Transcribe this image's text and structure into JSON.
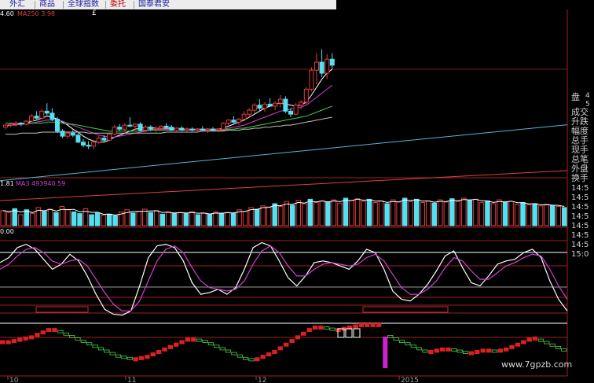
{
  "tabs": [
    {
      "label": "外汇",
      "active": false
    },
    {
      "label": "商品",
      "active": false
    },
    {
      "label": "全球指数",
      "active": false
    },
    {
      "label": "委托",
      "active": true
    },
    {
      "label": "国泰君安",
      "active": false
    }
  ],
  "pound_glyph": "£",
  "main_legend": {
    "left_value": "4.60",
    "ma250_label": "MA250 3.98"
  },
  "volume_legend": {
    "left_value": "1.81",
    "ma3_label": "MA3 493940.59"
  },
  "osc_legend": {
    "left_value": "0.00"
  },
  "side_panel": {
    "labels": [
      "盘",
      "成交",
      "升跌",
      "幅度",
      "总手",
      "现手",
      "总笔",
      "外盘",
      "换手"
    ],
    "right_digits": [
      "4",
      "5"
    ],
    "times": [
      "14:5",
      "14:5",
      "14:5",
      "14:5",
      "14:5",
      "14:5",
      "14:5",
      "15:0"
    ]
  },
  "x_axis": {
    "labels": [
      "10",
      "11",
      "12",
      "2015"
    ]
  },
  "watermark": "www.7gpzb.com",
  "colors": {
    "up": "#e33b3b",
    "down": "#54e0f0",
    "grid": "#6a1a1a",
    "background": "#000000"
  },
  "chart_data": [
    {
      "type": "line",
      "panel": "price",
      "description_of_marks": "daily candlesticks with moving averages",
      "candles": [
        [
          4.12,
          4.15,
          4.1,
          4.14
        ],
        [
          4.14,
          4.16,
          4.12,
          4.15
        ],
        [
          4.15,
          4.18,
          4.13,
          4.16
        ],
        [
          4.16,
          4.17,
          4.13,
          4.15
        ],
        [
          4.15,
          4.19,
          4.14,
          4.18
        ],
        [
          4.18,
          4.25,
          4.16,
          4.23
        ],
        [
          4.23,
          4.28,
          4.2,
          4.21
        ],
        [
          4.21,
          4.3,
          4.2,
          4.28
        ],
        [
          4.28,
          4.36,
          4.24,
          4.26
        ],
        [
          4.26,
          4.31,
          4.18,
          4.2
        ],
        [
          4.2,
          4.22,
          4.06,
          4.08
        ],
        [
          4.08,
          4.1,
          4.01,
          4.03
        ],
        [
          4.03,
          4.08,
          4.0,
          4.06
        ],
        [
          4.06,
          4.09,
          4.02,
          4.04
        ],
        [
          4.04,
          4.06,
          3.96,
          3.97
        ],
        [
          3.97,
          4.0,
          3.92,
          3.94
        ],
        [
          3.94,
          3.98,
          3.9,
          3.93
        ],
        [
          3.93,
          3.99,
          3.9,
          3.97
        ],
        [
          3.97,
          4.03,
          3.95,
          4.01
        ],
        [
          4.01,
          4.04,
          3.97,
          3.99
        ],
        [
          3.99,
          4.06,
          3.98,
          4.05
        ],
        [
          4.05,
          4.14,
          4.04,
          4.12
        ],
        [
          4.12,
          4.15,
          4.08,
          4.1
        ],
        [
          4.1,
          4.16,
          4.08,
          4.14
        ],
        [
          4.14,
          4.22,
          4.12,
          4.13
        ],
        [
          4.13,
          4.16,
          4.09,
          4.15
        ],
        [
          4.15,
          4.17,
          4.08,
          4.09
        ],
        [
          4.09,
          4.14,
          4.07,
          4.12
        ],
        [
          4.12,
          4.14,
          4.08,
          4.1
        ],
        [
          4.1,
          4.13,
          4.07,
          4.11
        ],
        [
          4.11,
          4.14,
          4.09,
          4.13
        ],
        [
          4.13,
          4.16,
          4.11,
          4.12
        ],
        [
          4.12,
          4.14,
          4.08,
          4.09
        ],
        [
          4.09,
          4.12,
          4.07,
          4.11
        ],
        [
          4.11,
          4.13,
          4.08,
          4.09
        ],
        [
          4.09,
          4.12,
          4.07,
          4.1
        ],
        [
          4.1,
          4.12,
          4.08,
          4.09
        ],
        [
          4.09,
          4.11,
          4.07,
          4.1
        ],
        [
          4.1,
          4.13,
          4.08,
          4.09
        ],
        [
          4.09,
          4.11,
          4.06,
          4.1
        ],
        [
          4.1,
          4.12,
          4.08,
          4.09
        ],
        [
          4.09,
          4.11,
          4.07,
          4.1
        ],
        [
          4.1,
          4.17,
          4.09,
          4.16
        ],
        [
          4.16,
          4.2,
          4.14,
          4.19
        ],
        [
          4.19,
          4.23,
          4.16,
          4.17
        ],
        [
          4.17,
          4.21,
          4.14,
          4.2
        ],
        [
          4.2,
          4.28,
          4.18,
          4.25
        ],
        [
          4.25,
          4.31,
          4.22,
          4.29
        ],
        [
          4.29,
          4.36,
          4.26,
          4.34
        ],
        [
          4.34,
          4.4,
          4.28,
          4.31
        ],
        [
          4.31,
          4.37,
          4.27,
          4.35
        ],
        [
          4.35,
          4.41,
          4.32,
          4.33
        ],
        [
          4.33,
          4.38,
          4.29,
          4.36
        ],
        [
          4.36,
          4.44,
          4.32,
          4.4
        ],
        [
          4.4,
          4.43,
          4.26,
          4.28
        ],
        [
          4.28,
          4.31,
          4.22,
          4.25
        ],
        [
          4.25,
          4.36,
          4.24,
          4.34
        ],
        [
          4.34,
          4.39,
          4.3,
          4.37
        ],
        [
          4.37,
          4.52,
          4.35,
          4.5
        ],
        [
          4.5,
          4.72,
          4.48,
          4.69
        ],
        [
          4.69,
          4.86,
          4.55,
          4.77
        ],
        [
          4.77,
          4.9,
          4.62,
          4.66
        ],
        [
          4.66,
          4.85,
          4.6,
          4.8
        ],
        [
          4.8,
          4.86,
          4.7,
          4.74
        ]
      ],
      "ma_series": [
        {
          "color": "#ffffff",
          "values": [
            4.13,
            4.14,
            4.15,
            4.15,
            4.16,
            4.18,
            4.19,
            4.21,
            4.23,
            4.22,
            4.2,
            4.17,
            4.14,
            4.1,
            4.07,
            4.03,
            4.0,
            3.98,
            3.97,
            3.97,
            3.99,
            4.02,
            4.04,
            4.06,
            4.08,
            4.1,
            4.11,
            4.12,
            4.12,
            4.11,
            4.11,
            4.11,
            4.11,
            4.11,
            4.1,
            4.1,
            4.1,
            4.1,
            4.1,
            4.1,
            4.1,
            4.1,
            4.11,
            4.13,
            4.15,
            4.17,
            4.19,
            4.22,
            4.25,
            4.28,
            4.31,
            4.33,
            4.35,
            4.36,
            4.35,
            4.34,
            4.33,
            4.34,
            4.37,
            4.44,
            4.52,
            4.6,
            4.66,
            4.7
          ]
        },
        {
          "color": "#d040d0",
          "values": [
            4.14,
            4.14,
            4.14,
            4.15,
            4.15,
            4.16,
            4.17,
            4.18,
            4.19,
            4.19,
            4.19,
            4.18,
            4.16,
            4.14,
            4.12,
            4.1,
            4.08,
            4.06,
            4.04,
            4.03,
            4.02,
            4.02,
            4.03,
            4.04,
            4.05,
            4.06,
            4.07,
            4.08,
            4.09,
            4.1,
            4.1,
            4.1,
            4.1,
            4.1,
            4.1,
            4.1,
            4.1,
            4.1,
            4.1,
            4.1,
            4.1,
            4.1,
            4.1,
            4.11,
            4.12,
            4.13,
            4.14,
            4.16,
            4.18,
            4.2,
            4.22,
            4.24,
            4.26,
            4.28,
            4.29,
            4.3,
            4.31,
            4.32,
            4.34,
            4.38,
            4.42,
            4.46,
            4.5,
            4.54
          ]
        },
        {
          "color": "#40d040",
          "values": [
            4.16,
            4.16,
            4.16,
            4.16,
            4.16,
            4.16,
            4.16,
            4.16,
            4.17,
            4.17,
            4.17,
            4.16,
            4.15,
            4.15,
            4.14,
            4.13,
            4.12,
            4.11,
            4.1,
            4.09,
            4.08,
            4.08,
            4.08,
            4.08,
            4.08,
            4.08,
            4.08,
            4.09,
            4.09,
            4.09,
            4.09,
            4.09,
            4.09,
            4.09,
            4.09,
            4.09,
            4.09,
            4.09,
            4.09,
            4.09,
            4.09,
            4.09,
            4.09,
            4.1,
            4.1,
            4.11,
            4.11,
            4.12,
            4.13,
            4.14,
            4.15,
            4.16,
            4.17,
            4.18,
            4.19,
            4.2,
            4.21,
            4.22,
            4.23,
            4.25,
            4.27,
            4.29,
            4.31,
            4.33
          ]
        },
        {
          "color": "#c0c0c0",
          "values": [
            4.05,
            4.05,
            4.05,
            4.06,
            4.06,
            4.06,
            4.06,
            4.07,
            4.07,
            4.07,
            4.07,
            4.07,
            4.07,
            4.07,
            4.07,
            4.07,
            4.06,
            4.06,
            4.06,
            4.06,
            4.06,
            4.06,
            4.06,
            4.06,
            4.06,
            4.06,
            4.06,
            4.06,
            4.06,
            4.06,
            4.06,
            4.07,
            4.07,
            4.07,
            4.07,
            4.07,
            4.07,
            4.07,
            4.08,
            4.08,
            4.08,
            4.08,
            4.08,
            4.09,
            4.09,
            4.09,
            4.1,
            4.1,
            4.11,
            4.11,
            4.12,
            4.12,
            4.13,
            4.13,
            4.14,
            4.14,
            4.15,
            4.16,
            4.17,
            4.18,
            4.19,
            4.2,
            4.21,
            4.22
          ]
        }
      ],
      "long_lines": [
        {
          "color": "#4fb7d8",
          "from": 3.82,
          "to": 4.38
        },
        {
          "color": "#e04040",
          "from": 3.7,
          "to": 4.0
        }
      ]
    },
    {
      "type": "bar",
      "panel": "volume",
      "values": [
        55,
        48,
        62,
        40,
        58,
        45,
        66,
        52,
        60,
        48,
        70,
        58,
        50,
        44,
        62,
        40,
        46,
        38,
        42,
        36,
        50,
        58,
        46,
        52,
        60,
        48,
        55,
        42,
        50,
        46,
        48,
        44,
        52,
        40,
        46,
        42,
        50,
        44,
        48,
        46,
        58,
        52,
        66,
        60,
        72,
        68,
        80,
        70,
        88,
        74,
        92,
        80,
        96,
        84,
        90,
        86,
        94,
        82,
        100,
        92,
        98,
        88,
        96,
        84,
        90,
        80,
        94,
        86,
        100,
        88,
        96,
        84,
        90,
        82,
        94,
        86,
        98,
        88,
        100,
        92,
        96,
        84,
        90,
        80,
        94,
        86,
        88,
        78,
        84,
        76,
        80,
        72,
        78,
        74,
        70,
        66
      ],
      "up_flags": [
        1,
        1,
        0,
        1,
        0,
        1,
        1,
        0,
        1,
        0,
        1,
        1,
        0,
        0,
        1,
        0,
        0,
        1,
        0,
        0,
        1,
        1,
        0,
        1,
        1,
        0,
        1,
        0,
        1,
        0,
        1,
        0,
        1,
        0,
        1,
        0,
        1,
        0,
        1,
        0,
        1,
        1,
        1,
        0,
        1,
        1,
        0,
        1,
        1,
        0,
        1,
        1,
        0,
        1,
        1,
        0,
        1,
        1,
        0,
        1,
        1,
        1,
        0,
        1,
        1,
        0,
        1,
        1,
        0,
        1,
        0,
        1,
        1,
        0,
        1,
        1,
        0,
        1,
        1,
        0,
        1,
        1,
        0,
        1,
        1,
        0,
        1,
        1,
        0,
        1,
        0,
        1,
        1,
        0,
        1,
        0
      ]
    },
    {
      "type": "line",
      "panel": "oscillator",
      "series": [
        {
          "color": "#ffffff",
          "values": [
            68,
            74,
            86,
            90,
            84,
            72,
            60,
            66,
            78,
            70,
            52,
            30,
            12,
            6,
            5,
            10,
            40,
            74,
            88,
            90,
            86,
            70,
            44,
            30,
            32,
            36,
            30,
            38,
            60,
            86,
            92,
            88,
            70,
            50,
            40,
            52,
            68,
            70,
            68,
            64,
            60,
            70,
            84,
            80,
            60,
            34,
            24,
            22,
            30,
            42,
            58,
            76,
            82,
            62,
            44,
            40,
            52,
            66,
            70,
            72,
            80,
            84,
            74,
            46,
            24,
            10
          ]
        },
        {
          "color": "#d040d0",
          "values": [
            60,
            66,
            76,
            84,
            86,
            80,
            70,
            66,
            70,
            72,
            64,
            48,
            32,
            18,
            10,
            10,
            22,
            46,
            70,
            84,
            88,
            80,
            62,
            46,
            38,
            36,
            34,
            36,
            46,
            66,
            82,
            88,
            80,
            64,
            52,
            52,
            60,
            66,
            68,
            66,
            64,
            66,
            74,
            78,
            70,
            54,
            38,
            30,
            30,
            36,
            46,
            62,
            74,
            70,
            58,
            48,
            48,
            56,
            64,
            68,
            74,
            78,
            76,
            60,
            40,
            24
          ]
        }
      ],
      "levels": [
        0,
        20,
        50,
        80,
        100
      ]
    },
    {
      "type": "bar",
      "panel": "step",
      "values": [
        8,
        8,
        9,
        10,
        11,
        12,
        14,
        16,
        18,
        18,
        16,
        14,
        12,
        10,
        8,
        6,
        4,
        2,
        0,
        -2,
        -4,
        -5,
        -6,
        -6,
        -5,
        -4,
        -2,
        0,
        2,
        4,
        6,
        8,
        10,
        10,
        9,
        8,
        6,
        4,
        2,
        0,
        -2,
        -4,
        -6,
        -7,
        -6,
        -4,
        -2,
        0,
        3,
        6,
        9,
        12,
        15,
        18,
        20,
        20,
        19,
        18,
        18,
        19,
        20,
        21,
        22,
        22,
        22,
        22,
        -10,
        12,
        10,
        8,
        6,
        4,
        2,
        0,
        0,
        1,
        2,
        2,
        1,
        0,
        -1,
        -1,
        0,
        1,
        1,
        0,
        1,
        2,
        4,
        6,
        8,
        10,
        11,
        9,
        7,
        5,
        3,
        1
      ]
    }
  ]
}
